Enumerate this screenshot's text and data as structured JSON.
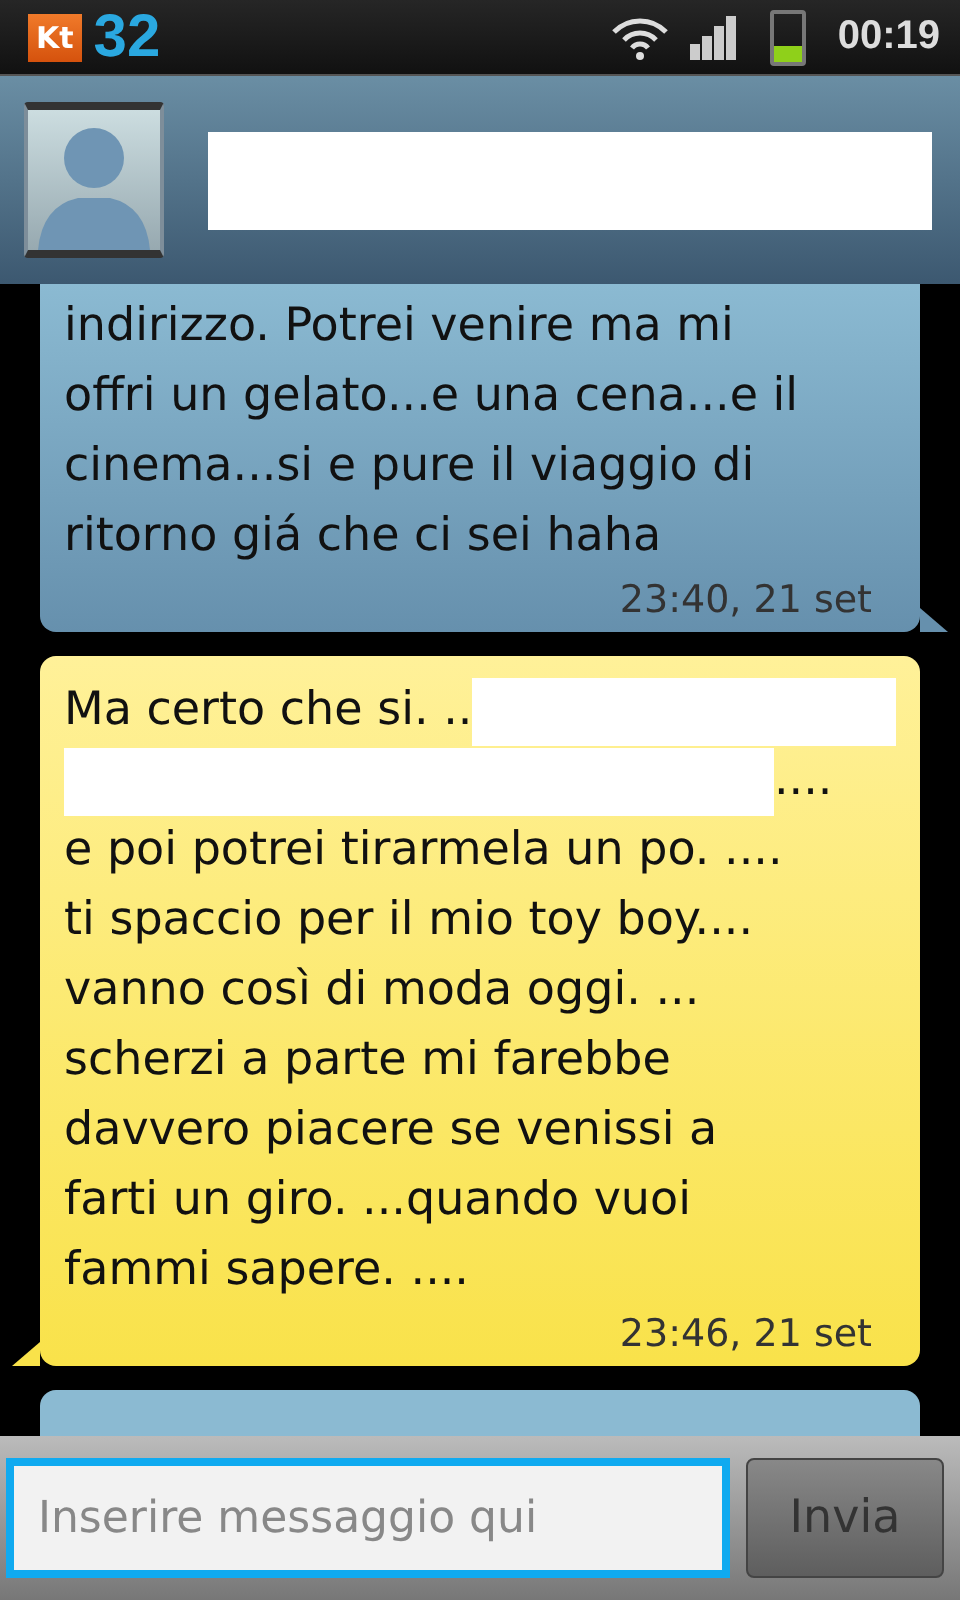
{
  "status_bar": {
    "app_badge": "Kt",
    "count": "32",
    "time": "00:19"
  },
  "contact": {
    "name_redacted": true
  },
  "messages": [
    {
      "kind": "received",
      "lines": [
        [
          {
            "kind": "text",
            "text": "indirizzo. Potrei venire ma mi"
          }
        ],
        [
          {
            "kind": "text",
            "text": "offri un gelato...e una cena...e il"
          }
        ],
        [
          {
            "kind": "text",
            "text": "cinema...si e pure il viaggio di"
          }
        ],
        [
          {
            "kind": "text",
            "text": "ritorno giá che ci sei haha"
          }
        ]
      ],
      "time": "23:40, 21 set"
    },
    {
      "kind": "sent",
      "lines": [
        [
          {
            "kind": "text",
            "text": "Ma certo che si. .."
          },
          {
            "kind": "redacted"
          }
        ],
        [
          {
            "kind": "redacted"
          },
          {
            "kind": "text",
            "text": "...."
          }
        ],
        [
          {
            "kind": "text",
            "text": "e poi potrei tirarmela un po. ...."
          }
        ],
        [
          {
            "kind": "text",
            "text": "ti spaccio per il mio toy boy...."
          }
        ],
        [
          {
            "kind": "text",
            "text": "vanno così di moda oggi. ..."
          }
        ],
        [
          {
            "kind": "text",
            "text": "scherzi a parte mi farebbe"
          }
        ],
        [
          {
            "kind": "text",
            "text": "davvero piacere se venissi a"
          }
        ],
        [
          {
            "kind": "text",
            "text": "farti un giro. ...quando vuoi"
          }
        ],
        [
          {
            "kind": "text",
            "text": "fammi sapere. ...."
          }
        ]
      ],
      "time": "23:46, 21 set"
    },
    {
      "kind": "received"
    }
  ],
  "composer": {
    "placeholder": "Inserire messaggio qui",
    "send": "Invia"
  }
}
